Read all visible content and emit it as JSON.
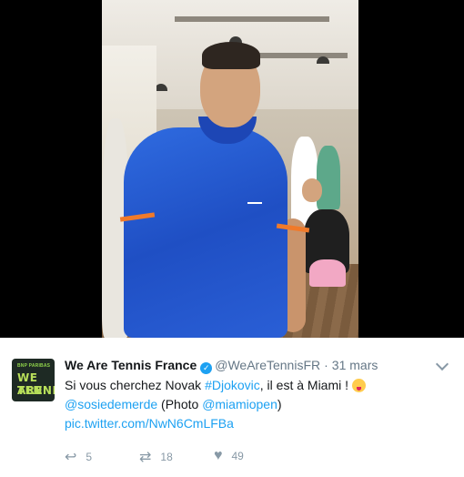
{
  "tweet": {
    "display_name": "We Are Tennis France",
    "handle": "@WeAreTennisFR",
    "separator": "·",
    "date": "31 mars",
    "avatar": {
      "brand_text": "BNP PARIBAS",
      "line1": "WE ARE",
      "line2": "TENNIS"
    },
    "text": {
      "part1": "Si vous cherchez Novak ",
      "hashtag": "#Djokovic",
      "part2": ", il est à Miami ! ",
      "mention1": "@sosiedemerde",
      "part3": " (Photo ",
      "mention2": "@miamiopen",
      "part4": ")",
      "pic_link": "pic.twitter.com/NwN6CmLFBa"
    },
    "actions": {
      "reply_count": "5",
      "retweet_count": "18",
      "like_count": "49"
    }
  },
  "icons": {
    "verified": "verified-badge-icon",
    "more": "chevron-down-icon",
    "reply": "reply-icon",
    "retweet": "retweet-icon",
    "like": "heart-icon"
  },
  "colors": {
    "link": "#1da1f2",
    "muted": "#657786",
    "text": "#14171a"
  }
}
